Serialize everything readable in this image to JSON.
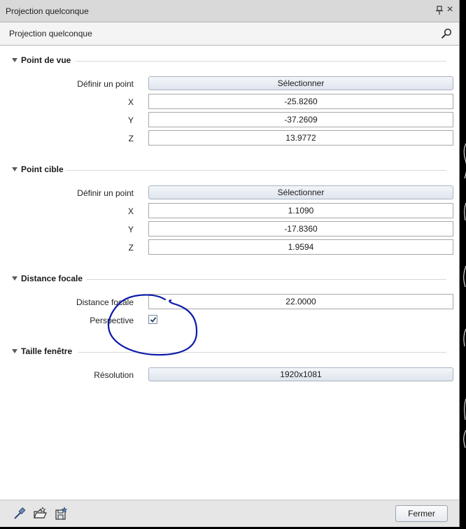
{
  "window": {
    "title": "Projection quelconque"
  },
  "panel": {
    "title": "Projection quelconque"
  },
  "sections": {
    "view_point": {
      "title": "Point de vue",
      "define_label": "Définir un point",
      "select_label": "Sélectionner",
      "x_label": "X",
      "x_value": "-25.8260",
      "y_label": "Y",
      "y_value": "-37.2609",
      "z_label": "Z",
      "z_value": "13.9772"
    },
    "target_point": {
      "title": "Point cible",
      "define_label": "Définir un point",
      "select_label": "Sélectionner",
      "x_label": "X",
      "x_value": "1.1090",
      "y_label": "Y",
      "y_value": "-17.8360",
      "z_label": "Z",
      "z_value": "1.9594"
    },
    "focal": {
      "title": "Distance focale",
      "distance_label": "Distance focale",
      "distance_value": "22.0000",
      "perspective_label": "Perspective",
      "perspective_checked": true
    },
    "window_size": {
      "title": "Taille fenêtre",
      "resolution_label": "Résolution",
      "resolution_value": "1920x1081"
    }
  },
  "footer": {
    "close_label": "Fermer"
  },
  "icons": {
    "title_pin": "pin-icon",
    "title_close": "close-icon",
    "search": "search-icon",
    "eyedropper": "eyedropper-icon",
    "open_favorite": "folder-star-icon",
    "save_favorite": "save-star-icon"
  },
  "colors": {
    "annotation": "#0a1aa8",
    "button_border": "#a9b3c0"
  }
}
